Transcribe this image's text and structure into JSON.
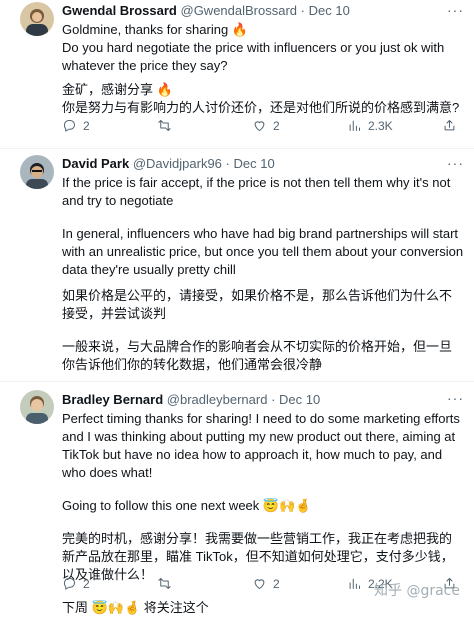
{
  "tweets": [
    {
      "name": "Gwendal Brossard",
      "handle": "@GwendalBrossard",
      "dot": "·",
      "date": "Dec 10",
      "more": "···",
      "lines": [
        "Goldmine, thanks for sharing 🔥",
        "Do you hard negotiate the price with influencers or you just ok with whatever the price they say?",
        "金矿，感谢分享 🔥",
        "你是努力与有影响力的人讨价还价，还是对他们所说的价格感到满意?"
      ],
      "replies": "2",
      "retweets": "",
      "likes": "2",
      "views": "2.3K"
    },
    {
      "name": "David Park",
      "handle": "@Davidjpark96",
      "dot": "·",
      "date": "Dec 10",
      "more": "···",
      "lines": [
        "If the price is fair accept, if the price is not then tell them why it's not and try to negotiate",
        "In general, influencers who have had big brand partnerships will start with an unrealistic price, but once you tell them about your conversion data they're usually pretty chill",
        "如果价格是公平的，请接受，如果价格不是，那么告诉他们为什么不接受，并尝试谈判",
        "一般来说，与大品牌合作的影响者会从不切实际的价格开始，但一旦你告诉他们你的转化数据，他们通常会很冷静"
      ]
    },
    {
      "name": "Bradley Bernard",
      "handle": "@bradleybernard",
      "dot": "·",
      "date": "Dec 10",
      "more": "···",
      "lines": [
        "Perfect timing thanks for sharing! I need to do some marketing efforts and I was thinking about putting my new product out there, aiming at TikTok but have no idea how to approach it, how much to pay, and who does what!",
        "Going to follow this one next week 😇🙌🤞",
        "完美的时机，感谢分享！我需要做一些营销工作，我正在考虑把我的新产品放在那里，瞄准 TikTok，但不知道如何处理它，支付多少钱，以及谁做什么！",
        "下周 😇🙌🤞 将关注这个"
      ],
      "replies": "2",
      "retweets": "",
      "likes": "2",
      "views": "2.2K"
    }
  ],
  "watermark": "知乎 @grace"
}
